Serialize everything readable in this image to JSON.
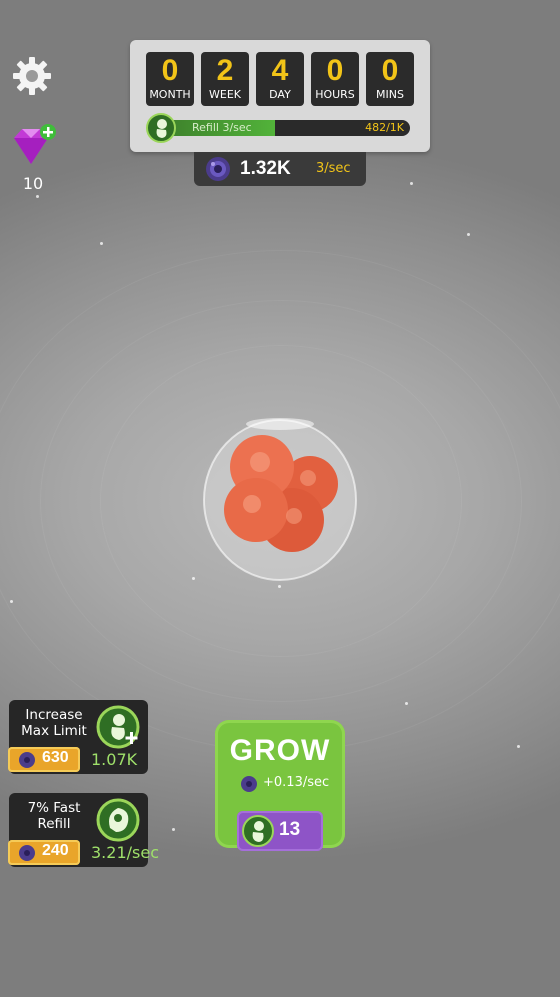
{
  "timer": {
    "cells": [
      {
        "value": "0",
        "label": "MONTH"
      },
      {
        "value": "2",
        "label": "WEEK"
      },
      {
        "value": "4",
        "label": "DAY"
      },
      {
        "value": "0",
        "label": "HOURS"
      },
      {
        "value": "0",
        "label": "MINS"
      }
    ],
    "refill_label": "Refill 3/sec",
    "refill_value": "482/1K",
    "refill_progress": 0.482
  },
  "currency": {
    "amount": "1.32K",
    "rate": "3/sec",
    "icon": "dna-cell-icon"
  },
  "gems": {
    "count": "10",
    "icon": "gem-icon"
  },
  "upgrades": [
    {
      "title_line1": "Increase",
      "title_line2": "Max Limit",
      "cost": "630",
      "value": "1.07K",
      "icon": "embryo-plus-icon"
    },
    {
      "title_line1": "7% Fast",
      "title_line2": "Refill",
      "cost": "240",
      "value": "3.21/sec",
      "icon": "fetus-head-icon"
    }
  ],
  "grow": {
    "label": "GROW",
    "rate": "+0.13/sec",
    "cost": "13"
  },
  "colors": {
    "accent_yellow": "#f2c418",
    "green_button": "#7ac53f",
    "purple_cost": "#8e54c7",
    "gold_cost": "#e9a52a"
  }
}
